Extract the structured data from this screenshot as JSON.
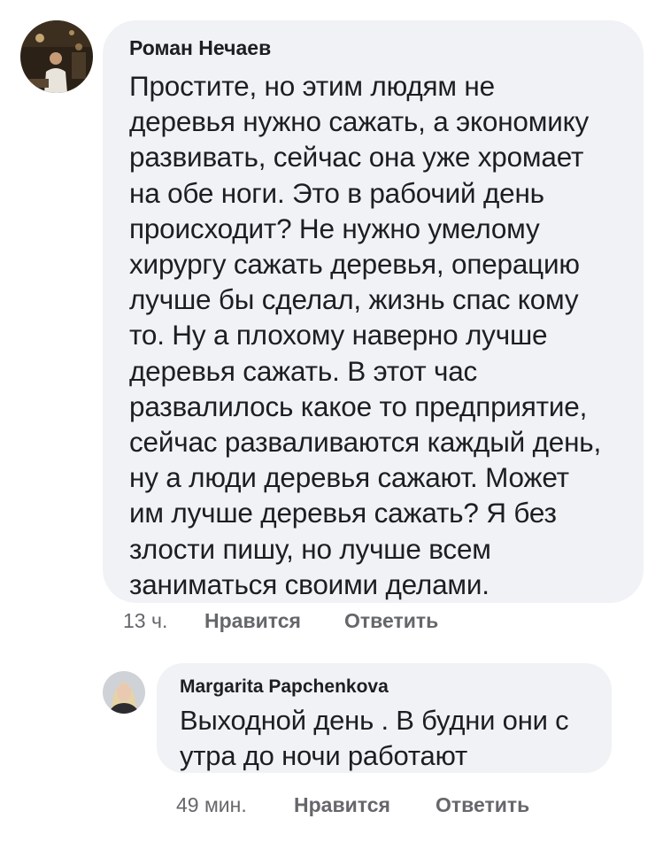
{
  "comments": [
    {
      "author": "Роман Нечаев",
      "text_lines": [
        "Простите, но этим людям не",
        "деревья нужно сажать, а экономику",
        "развивать, сейчас она уже хромает",
        "на обе ноги. Это в рабочий день",
        "происходит? Не нужно умелому",
        "хирургу сажать деревья, операцию",
        "лучше бы сделал, жизнь спас кому",
        "то. Ну а плохому наверно лучше",
        "деревья сажать. В этот час",
        "развалилось какое то предприятие,",
        "сейчас разваливаются каждый день,",
        "ну а люди деревья сажают. Может",
        "им лучше деревья сажать? Я без",
        "злости пишу, но лучше всем",
        "заниматься своими делами."
      ],
      "time": "13 ч.",
      "like_label": "Нравится",
      "reply_label": "Ответить"
    },
    {
      "author": "Margarita Papchenkova",
      "text_lines": [
        "Выходной день . В будни они с",
        "утра до ночи работают"
      ],
      "time": "49 мин.",
      "like_label": "Нравится",
      "reply_label": "Ответить"
    }
  ],
  "colors": {
    "bubble_background": "#f0f2f5",
    "text_primary": "#1c1e21",
    "text_secondary": "#65676b"
  }
}
